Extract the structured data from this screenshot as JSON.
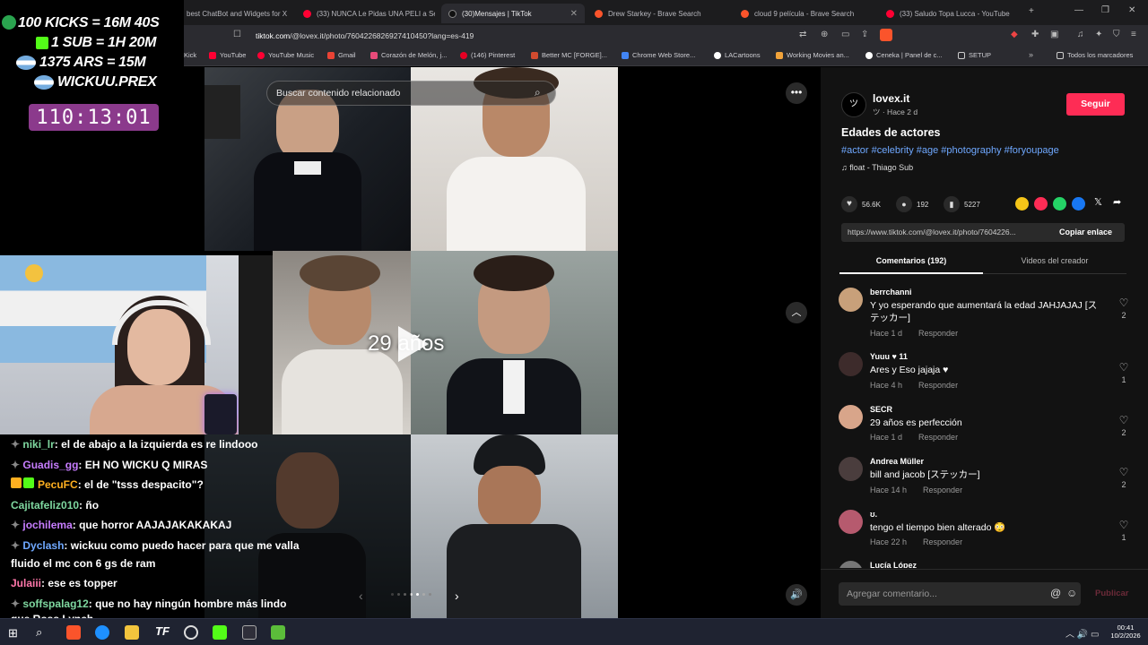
{
  "browser": {
    "tabs": [
      {
        "label": "best ChatBot and Widgets for X",
        "color": "#e63f3f"
      },
      {
        "label": "(33) NUNCA Le Pidas UNA PELI a Se",
        "color": "#ff0033"
      },
      {
        "label": "(30)Mensajes | TikTok",
        "color": "#111111"
      },
      {
        "label": "Drew Starkey - Brave Search",
        "color": "#fb542b"
      },
      {
        "label": "cloud 9 película - Brave Search",
        "color": "#fb542b"
      },
      {
        "label": "(33) Saludo Topa Lucca - YouTube",
        "color": "#ff0033"
      }
    ],
    "url_host": "tiktok.com",
    "url_path": "/@lovex.it/photo/7604226826927410450?lang=es-419",
    "bookmarks": [
      {
        "label": "Kick",
        "color": "#53fc18"
      },
      {
        "label": "YouTube",
        "color": "#ff0033"
      },
      {
        "label": "YouTube Music",
        "color": "#ff0033"
      },
      {
        "label": "Gmail",
        "color": "#ea4335"
      },
      {
        "label": "Corazón de Melón, j...",
        "color": "#e84b7a"
      },
      {
        "label": "(146) Pinterest",
        "color": "#e60023"
      },
      {
        "label": "Better MC [FORGE]...",
        "color": "#d14b2f"
      },
      {
        "label": "Chrome Web Store...",
        "color": "#4285f4"
      },
      {
        "label": "LACartoons",
        "color": "#ffffff"
      },
      {
        "label": "Working Movies an...",
        "color": "#f1a33a"
      },
      {
        "label": "Ceneka | Panel de c...",
        "color": "#ffffff"
      },
      {
        "label": "SETUP",
        "color": "#cccccc"
      },
      {
        "label": "Todos los marcadores",
        "color": "#cccccc"
      }
    ]
  },
  "overlay": {
    "lines": [
      "100 KICKS = 16M 40S",
      "1 SUB = 1H 20M",
      "1375 ARS = 15M",
      "WICKUU.PREX"
    ],
    "timer": "110:13:01"
  },
  "post": {
    "search_placeholder": "Buscar contenido relacionado",
    "overlay_text": "29 años",
    "author": "lovex.it",
    "author_meta": "ツ · Hace 2 d",
    "follow_label": "Seguir",
    "title": "Edades de actores",
    "hashtags": "#actor #celebrity #age #photography #foryoupage",
    "music": "float - Thiago Sub",
    "likes": "56.6K",
    "comments_count": "192",
    "saves": "5227",
    "share_url": "https://www.tiktok.com/@lovex.it/photo/7604226...",
    "copy_label": "Copiar enlace",
    "tab_comments": "Comentarios (192)",
    "tab_videos": "Videos del creador",
    "add_comment_placeholder": "Agregar comentario...",
    "publish_label": "Publicar"
  },
  "comments": [
    {
      "user": "berrchanni",
      "text": "Y yo esperando que aumentará la edad JAHJAJAJ [ステッカー]",
      "time": "Hace 1 d",
      "reply": "Responder",
      "likes": "2",
      "avatar": "#c8a07a"
    },
    {
      "user": "Yuuu ♥ 11",
      "text": "Ares y Eso jajaja ♥",
      "time": "Hace 4 h",
      "reply": "Responder",
      "likes": "1",
      "avatar": "#3d2b2b"
    },
    {
      "user": "SECR",
      "text": "29 años es perfección",
      "time": "Hace 1 d",
      "reply": "Responder",
      "likes": "2",
      "avatar": "#d8a58a"
    },
    {
      "user": "Andrea Müller",
      "text": "bill and jacob [ステッカー]",
      "time": "Hace 14 h",
      "reply": "Responder",
      "likes": "2",
      "avatar": "#4a3d3d"
    },
    {
      "user": "ʊ.",
      "text": "tengo el tiempo bien alterado 😳",
      "time": "Hace 22 h",
      "reply": "Responder",
      "likes": "1",
      "avatar": "#b65a6e"
    },
    {
      "user": "Lucía López",
      "text": "",
      "time": "",
      "reply": "",
      "likes": "",
      "avatar": "#777777"
    }
  ],
  "chat": [
    {
      "user": "niki_lr",
      "text": ": el de abajo a la izquierda es re lindooo",
      "color": "#7fd8a0"
    },
    {
      "user": "Guadis_gg",
      "text": ": EH NO WICKU Q MIRAS",
      "color": "#c77dff"
    },
    {
      "user": "PecuFC",
      "text": ": el de \"tsss despacito\"?",
      "color": "#ffb020"
    },
    {
      "user": "Cajitafeliz010",
      "text": ": ño",
      "color": "#7fd8a0"
    },
    {
      "user": "jochilema",
      "text": ": que horror AAJAJAKAKAKAJ",
      "color": "#c77dff"
    },
    {
      "user": "Dyclash",
      "text": ": wickuu como puedo hacer para que me valla",
      "color": "#6fa8ff"
    },
    {
      "user": "",
      "text": "fluido el mc con 6 gs de ram",
      "color": "#ffffff"
    },
    {
      "user": "Julaiii",
      "text": ": ese es topper",
      "color": "#ff77aa"
    },
    {
      "user": "soffspalag12",
      "text": ": que no hay ningún hombre más lindo",
      "color": "#7fd8a0"
    },
    {
      "user": "",
      "text": "que Ross Lynch",
      "color": "#ffffff"
    }
  ],
  "taskbar": {
    "time": "00:41",
    "date": "10/2/2026"
  }
}
